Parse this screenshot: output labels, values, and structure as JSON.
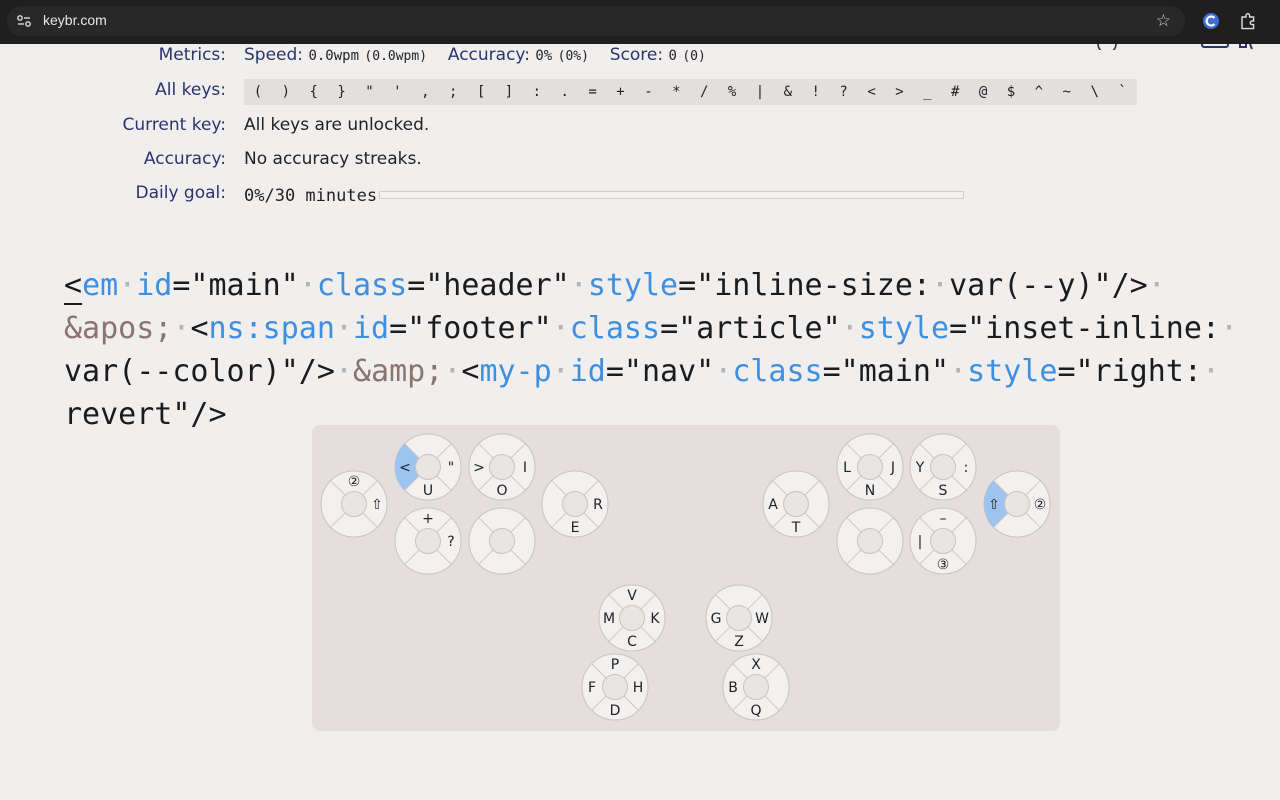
{
  "browser": {
    "url": "keybr.com"
  },
  "metrics": {
    "label": "Metrics:",
    "speed_label": "Speed:",
    "speed_value": "0.0wpm",
    "speed_paren": "(0.0wpm)",
    "accuracy_label": "Accuracy:",
    "accuracy_value": "0%",
    "accuracy_paren": "(0%)",
    "score_label": "Score:",
    "score_value": "0",
    "score_paren": "(0)"
  },
  "all_keys": {
    "label": "All keys:",
    "keys": [
      "(",
      ")",
      "{",
      "}",
      "\"",
      "'",
      ",",
      ";",
      "[",
      "]",
      ":",
      ".",
      "=",
      "+",
      "-",
      "*",
      "/",
      "%",
      "|",
      "&",
      "!",
      "?",
      "<",
      ">",
      "_",
      "#",
      "@",
      "$",
      "^",
      "~",
      "\\",
      "`"
    ]
  },
  "current_key": {
    "label": "Current key:",
    "value": "All keys are unlocked."
  },
  "accuracy_streak": {
    "label": "Accuracy:",
    "value": "No accuracy streaks."
  },
  "daily_goal": {
    "label": "Daily goal:",
    "value": "0%/30 minutes",
    "progress": 0
  },
  "colors": {
    "accent": "#3f8fe0",
    "entity": "#8a7470",
    "label": "#28346b",
    "highlight_key": "#9dc3ef"
  },
  "code_lines": [
    [
      [
        "<",
        "p"
      ],
      [
        "em",
        "n"
      ],
      [
        "·",
        "d"
      ],
      [
        "id",
        "n"
      ],
      [
        "=\"main\"",
        "p"
      ],
      [
        "·",
        "d"
      ],
      [
        "class",
        "n"
      ],
      [
        "=\"header\"",
        "p"
      ],
      [
        "·",
        "d"
      ],
      [
        "style",
        "n"
      ],
      [
        "=\"inline-size:",
        "p"
      ],
      [
        "·",
        "d"
      ],
      [
        "var(--y)\"/>",
        "p"
      ],
      [
        "·",
        "d"
      ]
    ],
    [
      [
        "&apos;",
        "e"
      ],
      [
        "·",
        "d"
      ],
      [
        "<",
        "p"
      ],
      [
        "ns:span",
        "n"
      ],
      [
        "·",
        "d"
      ],
      [
        "id",
        "n"
      ],
      [
        "=\"footer\"",
        "p"
      ],
      [
        "·",
        "d"
      ],
      [
        "class",
        "n"
      ],
      [
        "=\"article\"",
        "p"
      ],
      [
        "·",
        "d"
      ],
      [
        "style",
        "n"
      ],
      [
        "=\"inset-inline:",
        "p"
      ],
      [
        "·",
        "d"
      ]
    ],
    [
      [
        "var(--color)\"/>",
        "p"
      ],
      [
        "·",
        "d"
      ],
      [
        "&amp;",
        "e"
      ],
      [
        "·",
        "d"
      ],
      [
        "<",
        "p"
      ],
      [
        "my-p",
        "n"
      ],
      [
        "·",
        "d"
      ],
      [
        "id",
        "n"
      ],
      [
        "=\"nav\"",
        "p"
      ],
      [
        "·",
        "d"
      ],
      [
        "class",
        "n"
      ],
      [
        "=\"main\"",
        "p"
      ],
      [
        "·",
        "d"
      ],
      [
        "style",
        "n"
      ],
      [
        "=\"right:",
        "p"
      ],
      [
        "·",
        "d"
      ]
    ],
    [
      [
        "revert\"/>",
        "p"
      ]
    ]
  ],
  "keyboard": {
    "clusters": [
      {
        "name": "left-shift-cluster",
        "n": "②",
        "e": "⇧",
        "s": "",
        "w": "",
        "hl": ""
      },
      {
        "name": "left-index-upper",
        "n": "",
        "e": "\"",
        "s": "U",
        "w": "<",
        "hl": "w"
      },
      {
        "name": "left-index-upper-2",
        "n": "",
        "e": "I",
        "s": "O",
        "w": ">",
        "hl": ""
      },
      {
        "name": "left-index-lower",
        "n": "+",
        "e": "?",
        "s": "",
        "w": "",
        "hl": ""
      },
      {
        "name": "left-index-lower-2",
        "n": "",
        "e": "",
        "s": "",
        "w": "",
        "hl": ""
      },
      {
        "name": "left-middle",
        "n": "",
        "e": "R",
        "s": "E",
        "w": "",
        "hl": ""
      },
      {
        "name": "right-middle",
        "n": "",
        "e": "",
        "s": "T",
        "w": "A",
        "hl": ""
      },
      {
        "name": "right-index-upper",
        "n": "",
        "e": "J",
        "s": "N",
        "w": "L",
        "hl": ""
      },
      {
        "name": "right-index-upper-2",
        "n": "",
        "e": ":",
        "s": "S",
        "w": "Y",
        "hl": ""
      },
      {
        "name": "right-index-lower",
        "n": "",
        "e": "",
        "s": "",
        "w": "",
        "hl": ""
      },
      {
        "name": "right-index-lower-2",
        "n": "–",
        "e": "",
        "s": "③",
        "w": "|",
        "hl": ""
      },
      {
        "name": "right-shift-cluster",
        "n": "",
        "e": "②",
        "s": "",
        "w": "⇧",
        "hl": "w"
      },
      {
        "name": "left-thumb-upper",
        "n": "V",
        "e": "K",
        "s": "C",
        "w": "M",
        "hl": ""
      },
      {
        "name": "left-thumb-lower",
        "n": "",
        "e": "W",
        "s": "Z",
        "w": "G",
        "hl": ""
      },
      {
        "name": "right-thumb-upper",
        "n": "P",
        "e": "H",
        "s": "D",
        "w": "F",
        "hl": ""
      },
      {
        "name": "right-thumb-lower",
        "n": "X",
        "e": "",
        "s": "Q",
        "w": "B",
        "hl": ""
      }
    ]
  }
}
